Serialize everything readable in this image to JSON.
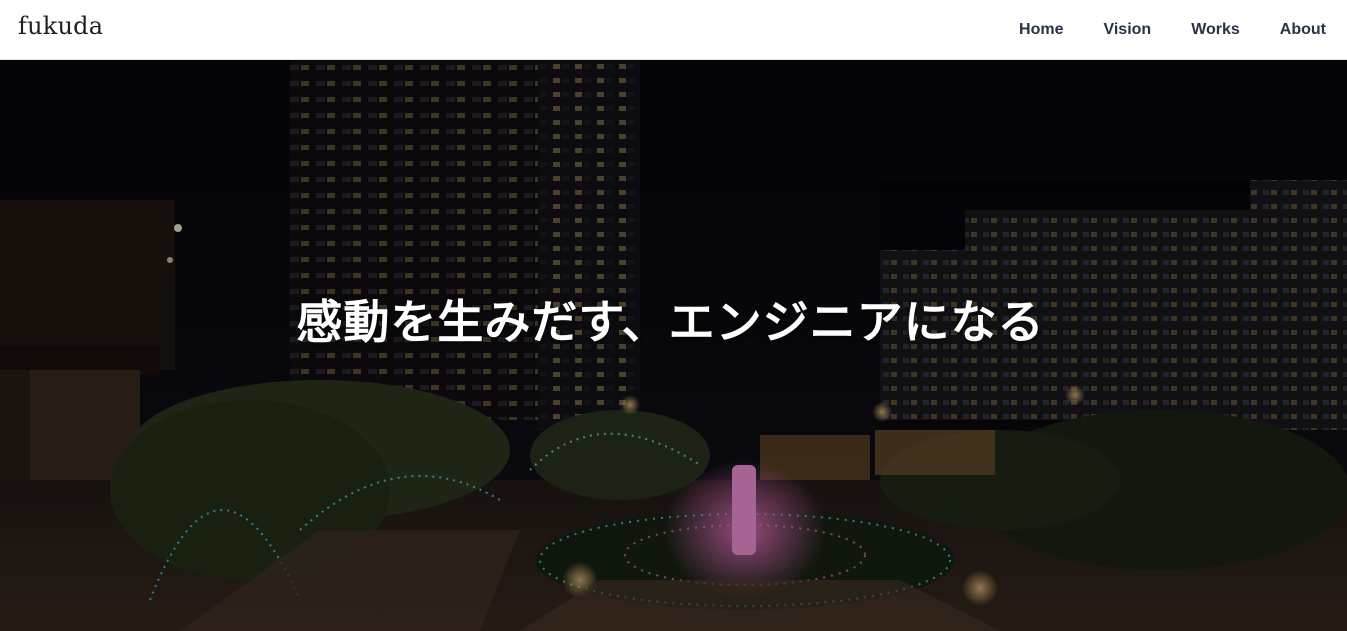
{
  "site": {
    "brand": "fukuda"
  },
  "nav": {
    "items": [
      "Home",
      "Vision",
      "Works",
      "About"
    ]
  },
  "hero": {
    "tagline": "感動を生みだす、エンジニアになる",
    "background": "night-rooftop-garden-with-illuminations-and-towers"
  },
  "colors": {
    "header_bg": "#ffffff",
    "nav_text": "#2a3346",
    "hero_text": "#ffffff",
    "sky": "#0b0b10"
  }
}
